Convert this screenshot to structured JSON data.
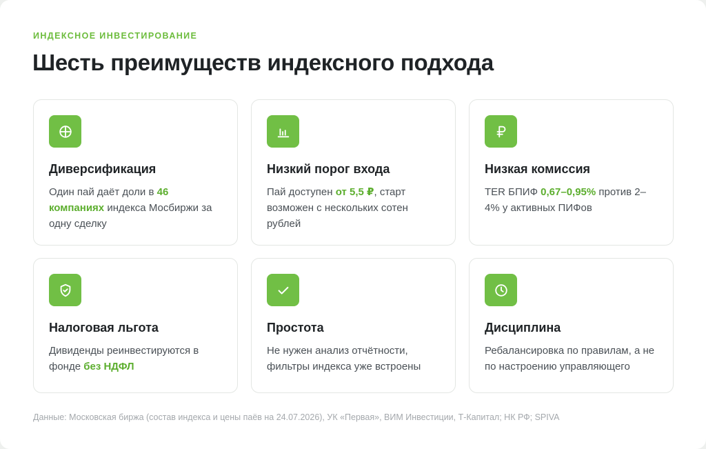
{
  "header": {
    "eyebrow": "ИНДЕКСНОЕ ИНВЕСТИРОВАНИЕ",
    "title": "Шесть преимуществ индексного подхода"
  },
  "colors": {
    "accent": "#71bf45",
    "highlight": "#5cae2e"
  },
  "cards": [
    {
      "icon": "crosshair-circle-icon",
      "title": "Диверсификация",
      "text_before": "Один пай даёт доли в ",
      "text_highlight": "46 компаниях",
      "text_after": " индекса Мосбиржи за одну сделку"
    },
    {
      "icon": "bar-chart-icon",
      "title": "Низкий порог входа",
      "text_before": "Пай доступен ",
      "text_highlight": "от 5,5 ₽",
      "text_after": ", старт возможен с нескольких сотен рублей"
    },
    {
      "icon": "ruble-icon",
      "title": "Низкая комиссия",
      "text_before": "TER БПИФ ",
      "text_highlight": "0,67–0,95%",
      "text_after": " против 2–4% у активных ПИФов"
    },
    {
      "icon": "shield-check-icon",
      "title": "Налоговая льгота",
      "text_before": "Дивиденды реинвестируются в фонде ",
      "text_highlight": "без НДФЛ",
      "text_after": ""
    },
    {
      "icon": "checkmark-icon",
      "title": "Простота",
      "text_before": "Не нужен анализ отчётности, фильтры индекса уже встроены",
      "text_highlight": "",
      "text_after": ""
    },
    {
      "icon": "clock-icon",
      "title": "Дисциплина",
      "text_before": "Ребалансировка по правилам, а не по настроению управляющего",
      "text_highlight": "",
      "text_after": ""
    }
  ],
  "footer": {
    "source": "Данные: Московская биржа (состав индекса и цены паёв на 24.07.2026), УК «Первая», ВИМ Инвестиции, Т-Капитал; НК РФ; SPIVA"
  }
}
